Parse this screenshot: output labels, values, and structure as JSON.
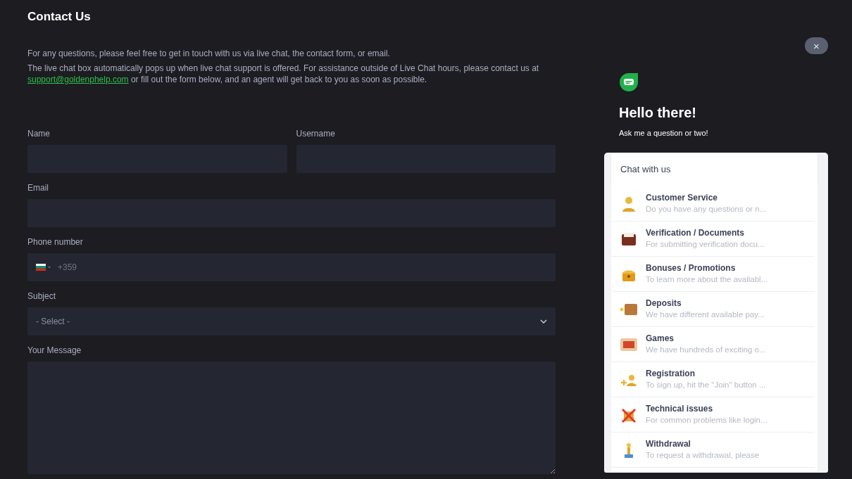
{
  "page": {
    "title": "Contact Us",
    "intro": "For any questions, please feel free to get in touch with us via live chat, the contact form, or email.",
    "info_start": "The live chat box automatically pops up when live chat support is offered. For assistance outside of Live Chat hours, please contact us at ",
    "email_link": "support@goldenphelp.com",
    "info_end": " or fill out the form below, and an agent will get back to you as soon as possible."
  },
  "form": {
    "fields": [
      {
        "label": "Name",
        "kind": "text",
        "half": true
      },
      {
        "label": "Username",
        "kind": "text",
        "half": true
      },
      {
        "label": "Email",
        "kind": "text",
        "half": false
      },
      {
        "label": "Phone number",
        "kind": "phone",
        "half": false,
        "placeholder": "+359"
      },
      {
        "label": "Subject",
        "kind": "select",
        "half": false,
        "value": "- Select -"
      },
      {
        "label": "Your Message",
        "kind": "textarea",
        "half": false
      }
    ]
  },
  "chat_widget": {
    "close": "×",
    "heading": "Hello there!",
    "subheading": "Ask me a question or two!",
    "card_title": "Chat with us",
    "topics": [
      {
        "title": "Customer Service",
        "description": "Do you have any questions or n..."
      },
      {
        "title": "Verification / Documents",
        "description": "For submitting verification docu..."
      },
      {
        "title": "Bonuses / Promotions",
        "description": "To learn more about the availabl..."
      },
      {
        "title": "Deposits",
        "description": "We have different available pay..."
      },
      {
        "title": "Games",
        "description": "We have hundreds of exciting o..."
      },
      {
        "title": "Registration",
        "description": "To sign up, hit the \"Join\" button ..."
      },
      {
        "title": "Technical issues",
        "description": "For common problems like login..."
      },
      {
        "title": "Withdrawal",
        "description": "To request a withdrawal, please"
      }
    ]
  }
}
